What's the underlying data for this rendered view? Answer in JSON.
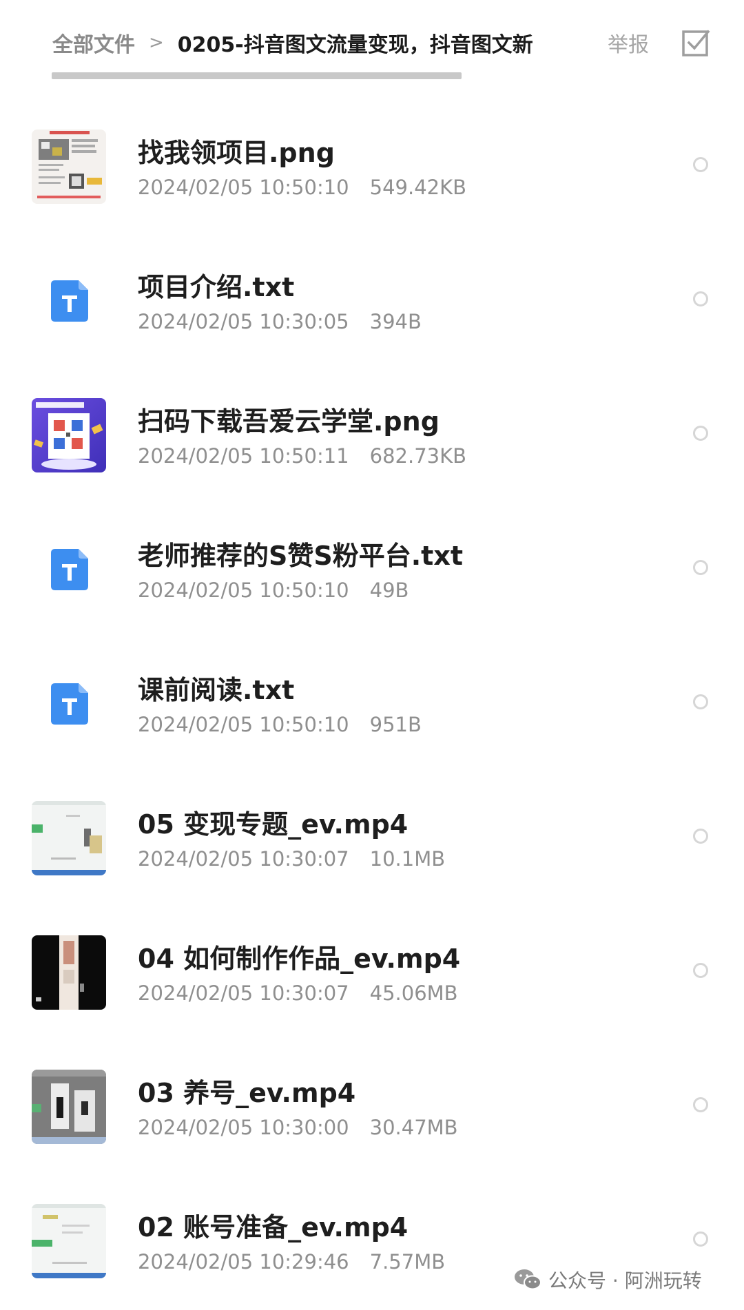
{
  "header": {
    "breadcrumb_root": "全部文件",
    "breadcrumb_separator": ">",
    "breadcrumb_current": "0205-抖音图文流量变现，抖音图文新",
    "report_label": "举报",
    "select_icon": "checkbox-icon"
  },
  "files": [
    {
      "name": "找我领项目.png",
      "date": "2024/02/05 10:50:10",
      "size": "549.42KB",
      "thumb": "image-thumbnail"
    },
    {
      "name": "项目介绍.txt",
      "date": "2024/02/05 10:30:05",
      "size": "394B",
      "thumb": "txt-file-icon"
    },
    {
      "name": "扫码下载吾爱云学堂.png",
      "date": "2024/02/05 10:50:11",
      "size": "682.73KB",
      "thumb": "image-thumbnail"
    },
    {
      "name": "老师推荐的S赞S粉平台.txt",
      "date": "2024/02/05 10:50:10",
      "size": "49B",
      "thumb": "txt-file-icon"
    },
    {
      "name": "课前阅读.txt",
      "date": "2024/02/05 10:50:10",
      "size": "951B",
      "thumb": "txt-file-icon"
    },
    {
      "name": "05 变现专题_ev.mp4",
      "date": "2024/02/05 10:30:07",
      "size": "10.1MB",
      "thumb": "video-thumbnail"
    },
    {
      "name": "04 如何制作作品_ev.mp4",
      "date": "2024/02/05 10:30:07",
      "size": "45.06MB",
      "thumb": "video-thumbnail"
    },
    {
      "name": "03 养号_ev.mp4",
      "date": "2024/02/05 10:30:00",
      "size": "30.47MB",
      "thumb": "video-thumbnail"
    },
    {
      "name": "02 账号准备_ev.mp4",
      "date": "2024/02/05 10:29:46",
      "size": "7.57MB",
      "thumb": "video-thumbnail"
    }
  ],
  "watermark": {
    "text": "公众号 · 阿洲玩转",
    "icon": "wechat-icon"
  },
  "colors": {
    "txt_icon_blue": "#3d8ef0",
    "radio_border": "#d6d6d6",
    "meta_gray": "#8f8f8f"
  }
}
